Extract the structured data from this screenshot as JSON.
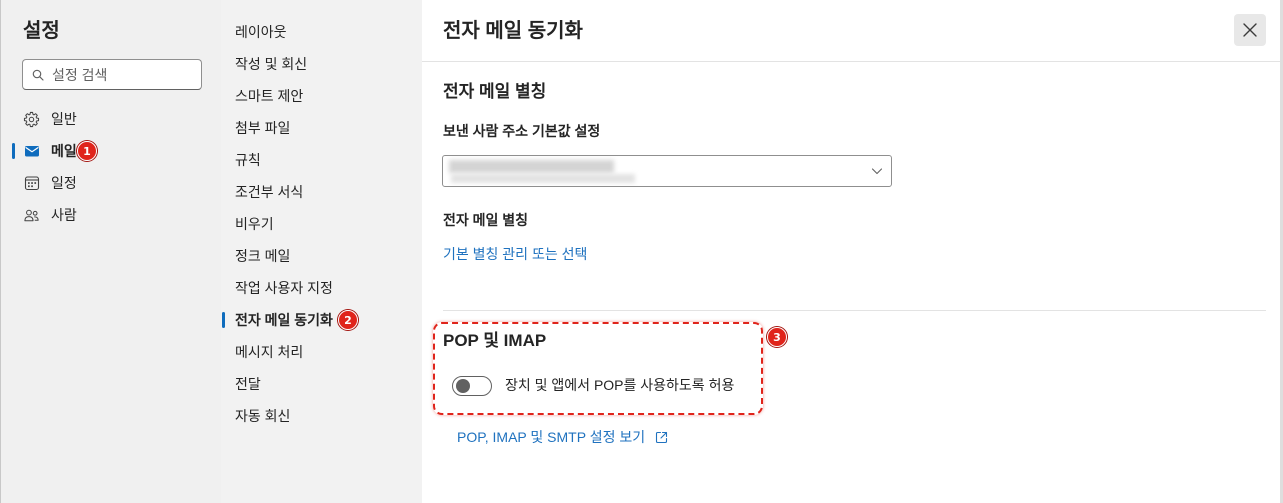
{
  "left_nav": {
    "title": "설정",
    "search": {
      "placeholder": "설정 검색",
      "value": "",
      "icon": "search-icon"
    },
    "items": [
      {
        "label": "일반",
        "icon": "gear-icon",
        "selected": false
      },
      {
        "label": "메일",
        "icon": "mail-icon",
        "selected": true
      },
      {
        "label": "일정",
        "icon": "calendar-icon",
        "selected": false
      },
      {
        "label": "사람",
        "icon": "people-icon",
        "selected": false
      }
    ]
  },
  "middle_nav": {
    "items": [
      {
        "label": "레이아웃",
        "selected": false
      },
      {
        "label": "작성 및 회신",
        "selected": false
      },
      {
        "label": "스마트 제안",
        "selected": false
      },
      {
        "label": "첨부 파일",
        "selected": false
      },
      {
        "label": "규칙",
        "selected": false
      },
      {
        "label": "조건부 서식",
        "selected": false
      },
      {
        "label": "비우기",
        "selected": false
      },
      {
        "label": "정크 메일",
        "selected": false
      },
      {
        "label": "작업 사용자 지정",
        "selected": false
      },
      {
        "label": "전자 메일 동기화",
        "selected": true
      },
      {
        "label": "메시지 처리",
        "selected": false
      },
      {
        "label": "전달",
        "selected": false
      },
      {
        "label": "자동 회신",
        "selected": false
      }
    ]
  },
  "content": {
    "title": "전자 메일 동기화",
    "close_icon": "close-icon",
    "email_aliases": {
      "heading": "전자 메일 별칭",
      "default_from_label": "보낸 사람 주소 기본값 설정",
      "dropdown_icon": "chevron-down-icon",
      "aliases_label": "전자 메일 별칭",
      "manage_aliases_link": "기본 별칭 관리 또는 선택"
    },
    "pop_imap": {
      "heading": "POP 및 IMAP",
      "allow_pop_toggle": {
        "label": "장치 및 앱에서 POP를 사용하도록 허용",
        "on": false
      },
      "settings_link": "POP, IMAP 및 SMTP 설정 보기",
      "settings_link_icon": "external-link-icon"
    }
  },
  "annotations": [
    {
      "number": "1"
    },
    {
      "number": "2"
    },
    {
      "number": "3"
    }
  ],
  "theme": {
    "accent": "#0f6cbd",
    "link": "#1f72bf",
    "text": "#242424",
    "annotation": "#e0241b",
    "divider": "#e3e3e3",
    "nav_bg": "#f0f0f0",
    "mid_bg": "#f2f2f2"
  }
}
